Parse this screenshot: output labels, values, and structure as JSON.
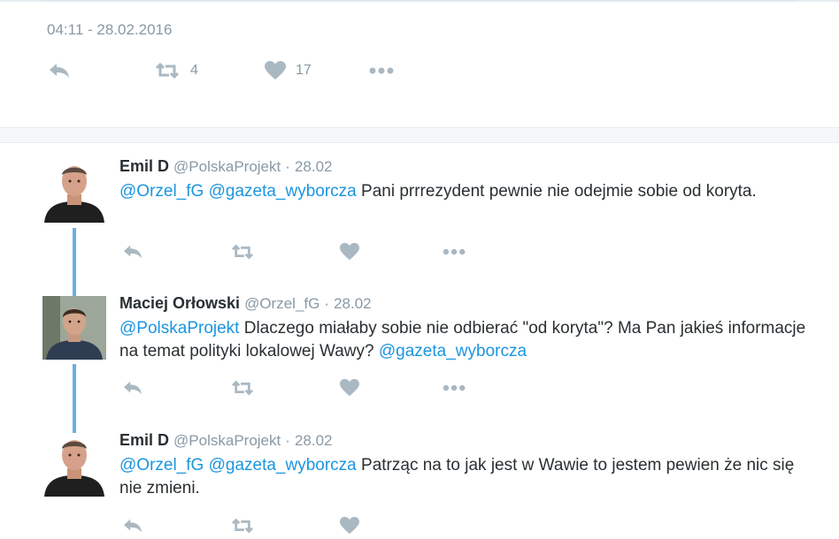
{
  "tweet": {
    "timestamp": "04:11 - 28.02.2016",
    "retweet_count": "4",
    "like_count": "17"
  },
  "replies": [
    {
      "name": "Emil D",
      "handle": "@PolskaProjekt",
      "date": "28.02",
      "mentions": [
        "@Orzel_fG",
        "@gazeta_wyborcza"
      ],
      "text": "Pani prrrezydent pewnie nie odejmie sobie od koryta."
    },
    {
      "name": "Maciej Orłowski",
      "handle": "@Orzel_fG",
      "date": "28.02",
      "mention_start": "@PolskaProjekt",
      "text": "Dlaczego miałaby sobie nie odbierać \"od koryta\"? Ma Pan jakieś informacje na temat polityki lokalowej Wawy?",
      "mention_end": "@gazeta_wyborcza"
    },
    {
      "name": "Emil D",
      "handle": "@PolskaProjekt",
      "date": "28.02",
      "mentions": [
        "@Orzel_fG",
        "@gazeta_wyborcza"
      ],
      "text": "Patrząc na to jak jest w Wawie to jestem pewien że nic się nie zmieni."
    }
  ],
  "separator_dot": "·",
  "icons": {
    "reply": "reply-icon",
    "retweet": "retweet-icon",
    "like": "heart-icon",
    "more": "more-icon"
  },
  "colors": {
    "link": "#1b95e0",
    "muted": "#8899a6",
    "icon": "#aab8c2",
    "thread_line": "#6bb0e0"
  }
}
